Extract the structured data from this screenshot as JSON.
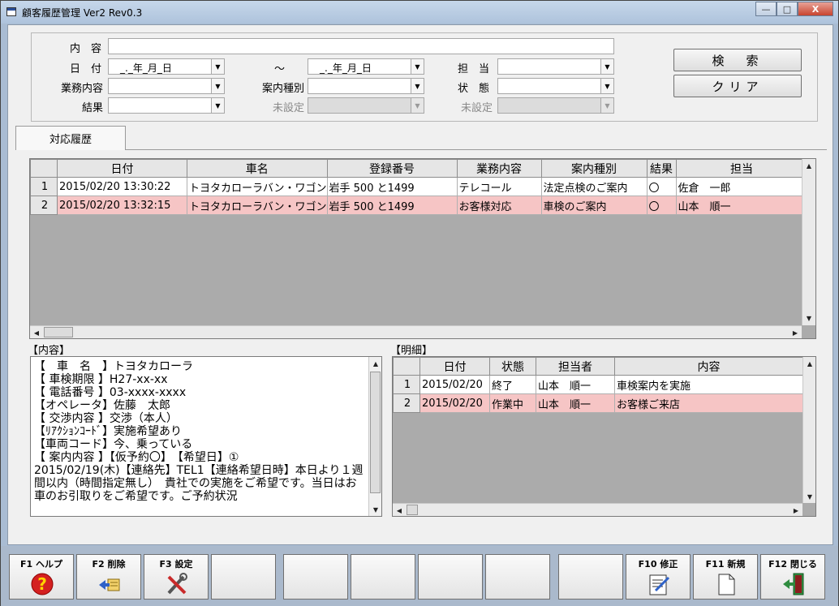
{
  "window": {
    "title": "顧客履歴管理 Ver2 Rev0.3",
    "min": "—",
    "max": "□",
    "close": "X"
  },
  "search": {
    "naiyou_label": "内　容",
    "hizuke_label": "日　付",
    "date_from": "_._年_月_日",
    "tilde": "～",
    "date_to": "_._年_月_日",
    "tantou_label": "担　当",
    "gyoumu_label": "業務内容",
    "annai_label": "案内種別",
    "joutai_label": "状　態",
    "kekka_label": "結果",
    "misettei1": "未設定",
    "misettei2": "未設定",
    "search_button": "検　索",
    "clear_button": "クリア"
  },
  "tab": {
    "label": "対応履歴"
  },
  "history": {
    "columns": [
      "日付",
      "車名",
      "登録番号",
      "業務内容",
      "案内種別",
      "結果",
      "担当"
    ],
    "rows": [
      {
        "no": "1",
        "date": "2015/02/20 13:30:22",
        "car": "トヨタカローラバン・ワゴン",
        "plate": "岩手 500 と1499",
        "gyoumu": "テレコール",
        "annai": "法定点検のご案内",
        "kekka": "〇",
        "tantou": "佐倉　一郎"
      },
      {
        "no": "2",
        "date": "2015/02/20 13:32:15",
        "car": "トヨタカローラバン・ワゴン",
        "plate": "岩手 500 と1499",
        "gyoumu": "お客様対応",
        "annai": "車検のご案内",
        "kekka": "〇",
        "tantou": "山本　順一"
      }
    ]
  },
  "content": {
    "label": "【内容】",
    "text": "【　車　名　】トヨタカローラ\n【 車検期限 】H27-xx-xx\n【 電話番号 】03-xxxx-xxxx\n【オペレータ】佐藤　太郎\n【 交渉内容 】交渉（本人）\n【ﾘｱｸｼｮﾝｺｰﾄﾞ】実施希望あり\n【車両コード】今、乗っている\n【 案内内容 】【仮予約〇】　【希望日】①\n2015/02/19(木)【連絡先】TEL1【連絡希望日時】本日より１週間以内（時間指定無し）　貴社での実施をご希望です。当日はお車のお引取りをご希望です。ご予約状況"
  },
  "detail": {
    "label": "【明細】",
    "columns": [
      "日付",
      "状態",
      "担当者",
      "内容"
    ],
    "rows": [
      {
        "no": "1",
        "date": "2015/02/20",
        "status": "終了",
        "person": "山本　順一",
        "content": "車検案内を実施"
      },
      {
        "no": "2",
        "date": "2015/02/20",
        "status": "作業中",
        "person": "山本　順一",
        "content": "お客様ご来店"
      }
    ]
  },
  "fkeys": {
    "f1": "F1 ヘルプ",
    "f2": "F2 削除",
    "f3": "F3 設定",
    "f10": "F10 修正",
    "f11": "F11 新規",
    "f12": "F12 閉じる"
  },
  "colors": {
    "selected_row": "#f6c5c5",
    "grid_bg": "#ababab",
    "client_bg": "#f0f0f0",
    "frame": "#a9bcd3"
  }
}
